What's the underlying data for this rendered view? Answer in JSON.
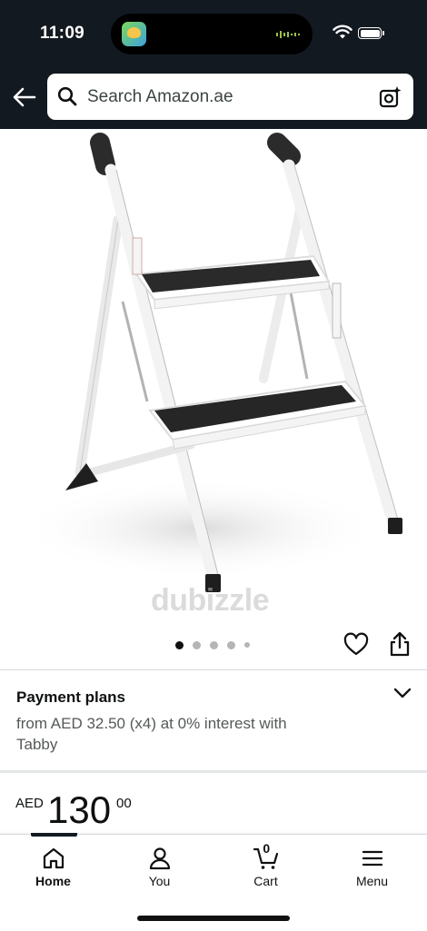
{
  "status_bar": {
    "time": "11:09"
  },
  "search": {
    "placeholder": "Search Amazon.ae"
  },
  "product_image": {
    "watermark": "dubizzle",
    "total_images": 5,
    "current_image": 1
  },
  "payment_plans": {
    "title": "Payment plans",
    "detail": "from AED 32.50 (x4) at 0% interest with Tabby"
  },
  "price": {
    "currency": "AED",
    "whole": "130",
    "fraction": "00"
  },
  "bottom_nav": {
    "items": [
      {
        "label": "Home",
        "icon": "home-icon",
        "active": true
      },
      {
        "label": "You",
        "icon": "user-icon",
        "active": false
      },
      {
        "label": "Cart",
        "icon": "cart-icon",
        "active": false,
        "count": "0"
      },
      {
        "label": "Menu",
        "icon": "menu-icon",
        "active": false
      }
    ]
  },
  "colors": {
    "header_bg": "#131921",
    "text": "#0f1111",
    "secondary_text": "#565959"
  }
}
